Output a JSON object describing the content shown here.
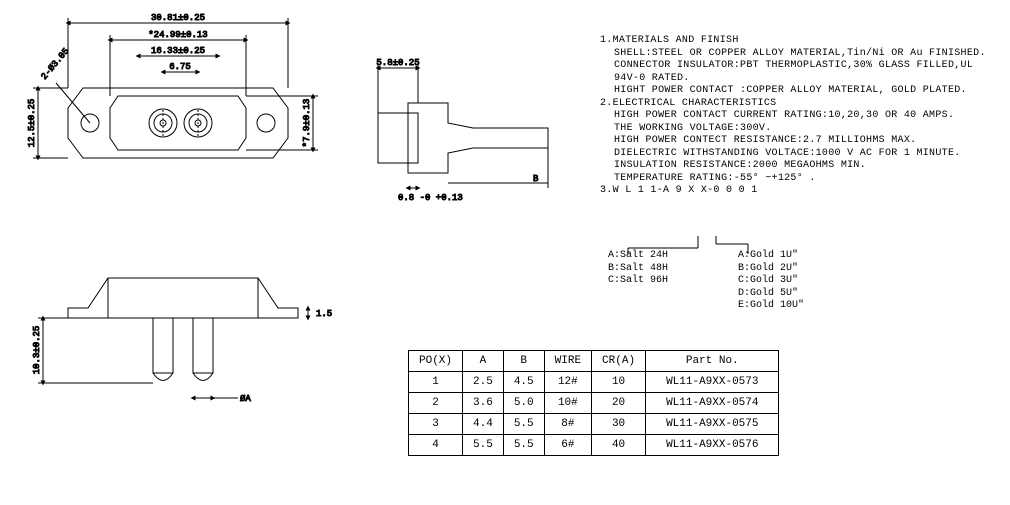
{
  "dimensions": {
    "front": {
      "width_overall": "30.81±0.25",
      "width_inner": "*24.99±0.13",
      "width_contact_spacing": "16.33±0.25",
      "width_pitch": "6.75",
      "mount_hole": "2-Ø3.05",
      "height_left": "12.5±0.25",
      "height_right": "*7.9±0.13"
    },
    "side": {
      "top": "5.8±0.25",
      "thickness": "0.8 -0 +0.13",
      "dim_b_label": "B"
    },
    "bottom": {
      "depth": "10.3±0.25",
      "lip": "1.5",
      "diameter": "ØA"
    }
  },
  "notes": {
    "n1_title": "1.MATERIALS AND  FINISH",
    "n1_shell": "SHELL:STEEL OR COPPER ALLOY MATERIAL,Tin/Ni OR Au FINISHED.",
    "n1_connector": "CONNECTOR INSULATOR:PBT THERMOPLASTIC,30% GLASS FILLED,UL 94V-0 RATED.",
    "n1_contact": "HIGHT POWER CONTACT :COPPER ALLOY MATERIAL, GOLD PLATED.",
    "n2_title": "2.ELECTRICAL CHARACTERISTICS",
    "n2_current": "HIGH POWER CONTACT CURRENT RATING:10,20,30 OR 40 AMPS.",
    "n2_voltage": "THE WORKING VOLTAGE:300V.",
    "n2_resistance": "HIGH POWER CONTECT RESISTANCE:2.7 MILLIOHMS MAX.",
    "n2_dielectric": "DIELECTRIC WITHSTANDING VOLTACE:1000 V AC FOR 1 MINUTE.",
    "n2_insulation": "INSULATION RESISTANCE:2000 MEGAOHMS MIN.",
    "n2_temp": "TEMPERATURE RATING:-55° ~+125° .",
    "n3_title": "3.W L 1 1-A 9 X X-0 0 0 1"
  },
  "code_tree": {
    "left": {
      "a": "A:Salt 24H",
      "b": "B:Salt 48H",
      "c": "C:Salt 96H"
    },
    "right": {
      "a": "A:Gold 1U″",
      "b": "B:Gold 2U″",
      "c": "C:Gold 3U″",
      "d": "D:Gold 5U″",
      "e": "E:Gold 10U″"
    }
  },
  "table": {
    "headers": {
      "po": "PO(X)",
      "a": "A",
      "b": "B",
      "wire": "WIRE",
      "cr": "CR(A)",
      "part": "Part  No."
    },
    "rows": [
      {
        "po": "1",
        "a": "2.5",
        "b": "4.5",
        "wire": "12#",
        "cr": "10",
        "part": "WL11-A9XX-0573"
      },
      {
        "po": "2",
        "a": "3.6",
        "b": "5.0",
        "wire": "10#",
        "cr": "20",
        "part": "WL11-A9XX-0574"
      },
      {
        "po": "3",
        "a": "4.4",
        "b": "5.5",
        "wire": "8#",
        "cr": "30",
        "part": "WL11-A9XX-0575"
      },
      {
        "po": "4",
        "a": "5.5",
        "b": "5.5",
        "wire": "6#",
        "cr": "40",
        "part": "WL11-A9XX-0576"
      }
    ]
  }
}
